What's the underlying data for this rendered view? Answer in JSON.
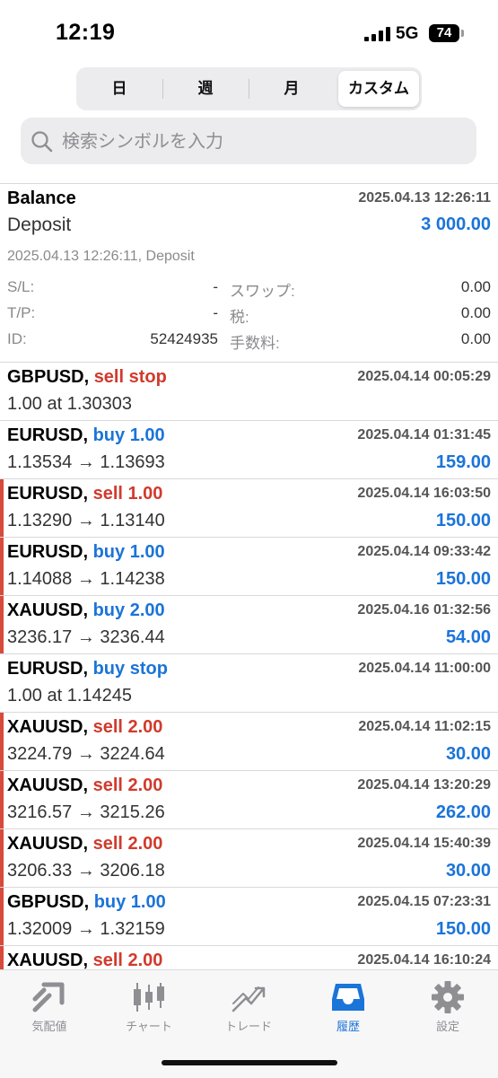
{
  "status_bar": {
    "time": "12:19",
    "network": "5G",
    "battery": "74"
  },
  "segments": [
    {
      "label": "日",
      "active": false
    },
    {
      "label": "週",
      "active": false
    },
    {
      "label": "月",
      "active": false
    },
    {
      "label": "カスタム",
      "active": true
    }
  ],
  "search": {
    "placeholder": "検索シンボルを入力"
  },
  "balance": {
    "title": "Balance",
    "time": "2025.04.13 12:26:11",
    "subtitle": "Deposit",
    "amount": "3 000.00",
    "comment": "2025.04.13 12:26:11, Deposit",
    "sl_label": "S/L:",
    "sl_value": "-",
    "tp_label": "T/P:",
    "tp_value": "-",
    "id_label": "ID:",
    "id_value": "52424935",
    "swap_label": "スワップ:",
    "swap_value": "0.00",
    "tax_label": "税:",
    "tax_value": "0.00",
    "fee_label": "手数料:",
    "fee_value": "0.00"
  },
  "rows": [
    {
      "symbol": "GBPUSD,",
      "type": "sell stop",
      "side": "sell",
      "time": "2025.04.14 00:05:29",
      "price": "1.00 at 1.30303",
      "profit": "",
      "loss_bar": false
    },
    {
      "symbol": "EURUSD,",
      "type": "buy 1.00",
      "side": "buy",
      "time": "2025.04.14 01:31:45",
      "price": "1.13534 → 1.13693",
      "profit": "159.00",
      "loss_bar": false
    },
    {
      "symbol": "EURUSD,",
      "type": "sell 1.00",
      "side": "sell",
      "time": "2025.04.14 16:03:50",
      "price": "1.13290 → 1.13140",
      "profit": "150.00",
      "loss_bar": true
    },
    {
      "symbol": "EURUSD,",
      "type": "buy 1.00",
      "side": "buy",
      "time": "2025.04.14 09:33:42",
      "price": "1.14088 → 1.14238",
      "profit": "150.00",
      "loss_bar": true
    },
    {
      "symbol": "XAUUSD,",
      "type": "buy 2.00",
      "side": "buy",
      "time": "2025.04.16 01:32:56",
      "price": "3236.17 → 3236.44",
      "profit": "54.00",
      "loss_bar": true
    },
    {
      "symbol": "EURUSD,",
      "type": "buy stop",
      "side": "buy",
      "time": "2025.04.14 11:00:00",
      "price": "1.00 at 1.14245",
      "profit": "",
      "loss_bar": false
    },
    {
      "symbol": "XAUUSD,",
      "type": "sell 2.00",
      "side": "sell",
      "time": "2025.04.14 11:02:15",
      "price": "3224.79 → 3224.64",
      "profit": "30.00",
      "loss_bar": true
    },
    {
      "symbol": "XAUUSD,",
      "type": "sell 2.00",
      "side": "sell",
      "time": "2025.04.14 13:20:29",
      "price": "3216.57 → 3215.26",
      "profit": "262.00",
      "loss_bar": true
    },
    {
      "symbol": "XAUUSD,",
      "type": "sell 2.00",
      "side": "sell",
      "time": "2025.04.14 15:40:39",
      "price": "3206.33 → 3206.18",
      "profit": "30.00",
      "loss_bar": true
    },
    {
      "symbol": "GBPUSD,",
      "type": "buy 1.00",
      "side": "buy",
      "time": "2025.04.15 07:23:31",
      "price": "1.32009 → 1.32159",
      "profit": "150.00",
      "loss_bar": true
    },
    {
      "symbol": "XAUUSD,",
      "type": "sell 2.00",
      "side": "sell",
      "time": "2025.04.14 16:10:24",
      "price": "",
      "profit": "",
      "loss_bar": true
    }
  ],
  "tabbar": [
    {
      "label": "気配値",
      "icon": "quotes-icon",
      "active": false
    },
    {
      "label": "チャート",
      "icon": "chart-icon",
      "active": false
    },
    {
      "label": "トレード",
      "icon": "trade-icon",
      "active": false
    },
    {
      "label": "履歴",
      "icon": "history-icon",
      "active": true
    },
    {
      "label": "設定",
      "icon": "settings-icon",
      "active": false
    }
  ],
  "colors": {
    "accent": "#1b74d8",
    "sell": "#d13a2c",
    "loss_bar": "#d84a3c"
  }
}
